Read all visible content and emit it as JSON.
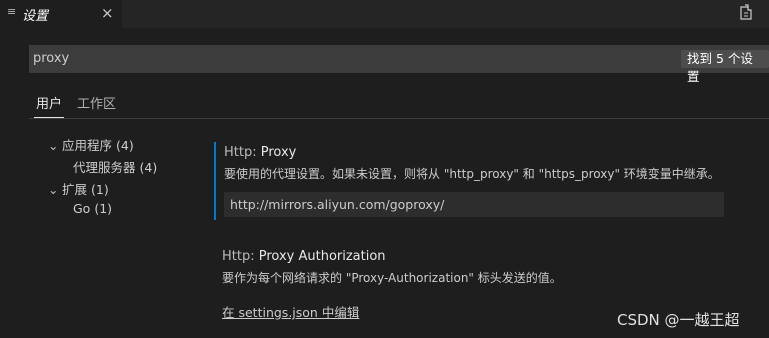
{
  "tab": {
    "title": "设置",
    "close": "×",
    "icon": "list-icon"
  },
  "search": {
    "query": "proxy",
    "result_count": "找到 5 个设置"
  },
  "scopes": {
    "user": "用户",
    "workspace": "工作区"
  },
  "toc": [
    {
      "label": "应用程序",
      "count": "(4)",
      "expanded": true
    },
    {
      "label": "代理服务器",
      "count": "(4)"
    },
    {
      "label": "扩展",
      "count": "(1)",
      "expanded": true
    },
    {
      "label": "Go",
      "count": "(1)"
    }
  ],
  "settings": [
    {
      "category": "Http: ",
      "name": "Proxy",
      "description": "要使用的代理设置。如果未设置，则将从 \"http_proxy\" 和 \"https_proxy\" 环境变量中继承。",
      "value": "http://mirrors.aliyun.com/goproxy/"
    },
    {
      "category": "Http: ",
      "name": "Proxy Authorization",
      "description": "要作为每个网络请求的 \"Proxy-Authorization\" 标头发送的值。",
      "link": "在 settings.json 中编辑"
    }
  ],
  "watermark": "CSDN @一越王超",
  "colors": {
    "accent": "#007acc",
    "background": "#1e1e1e",
    "input_bg": "#3c3c3c"
  }
}
